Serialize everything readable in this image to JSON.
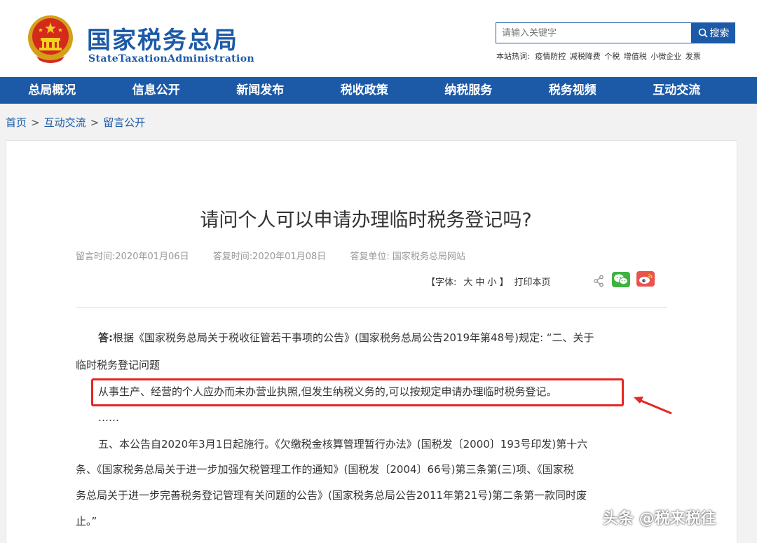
{
  "header": {
    "title": "国家税务总局",
    "subtitle": "StateTaxationAdministration",
    "search": {
      "placeholder": "请输入关键字",
      "button_label": "搜索"
    },
    "hot_words": {
      "label": "本站热词:",
      "items": [
        "疫情防控",
        "减税降费",
        "个税",
        "增值税",
        "小微企业",
        "发票"
      ]
    }
  },
  "nav": {
    "items": [
      "总局概况",
      "信息公开",
      "新闻发布",
      "税收政策",
      "纳税服务",
      "税务视频",
      "互动交流"
    ]
  },
  "breadcrumb": {
    "items": [
      "首页",
      "互动交流",
      "留言公开"
    ],
    "separator": ">"
  },
  "article": {
    "title": "请问个人可以申请办理临时税务登记吗?",
    "meta": {
      "message_time": "留言时间:2020年01月06日",
      "reply_time": "答复时间:2020年01月08日",
      "reply_unit": "答复单位:  国家税务总局网站"
    },
    "tools": {
      "font_label": "【字体:",
      "sizes": [
        "大",
        "中",
        "小"
      ],
      "font_end": "】",
      "print_label": "打印本页"
    },
    "body": {
      "answer_label": "答:",
      "line1": "根据《国家税务总局关于税收征管若干事项的公告》(国家税务总局公告2019年第48号)规定:  “二、关于",
      "line2": "临时税务登记问题",
      "highlighted": "从事生产、经营的个人应办而未办营业执照,但发生纳税义务的,可以按规定申请办理临时税务登记。",
      "ellipsis": "……",
      "line4": "五、本公告自2020年3月1日起施行。《欠缴税金核算管理暂行办法》(国税发〔2000〕193号印发)第十六",
      "line5": "条、《国家税务总局关于进一步加强欠税管理工作的通知》(国税发〔2004〕66号)第三条第(三)项、《国家税",
      "line6": "务总局关于进一步完善税务登记管理有关问题的公告》(国家税务总局公告2011年第21号)第二条第一款同时废",
      "line7": "止。”"
    }
  },
  "watermark": "头条 @税来税往",
  "colors": {
    "brand_blue": "#1c5aa8",
    "highlight_red": "#e62722",
    "wechat_green": "#3fb33f",
    "weibo_red": "#e9534f"
  }
}
